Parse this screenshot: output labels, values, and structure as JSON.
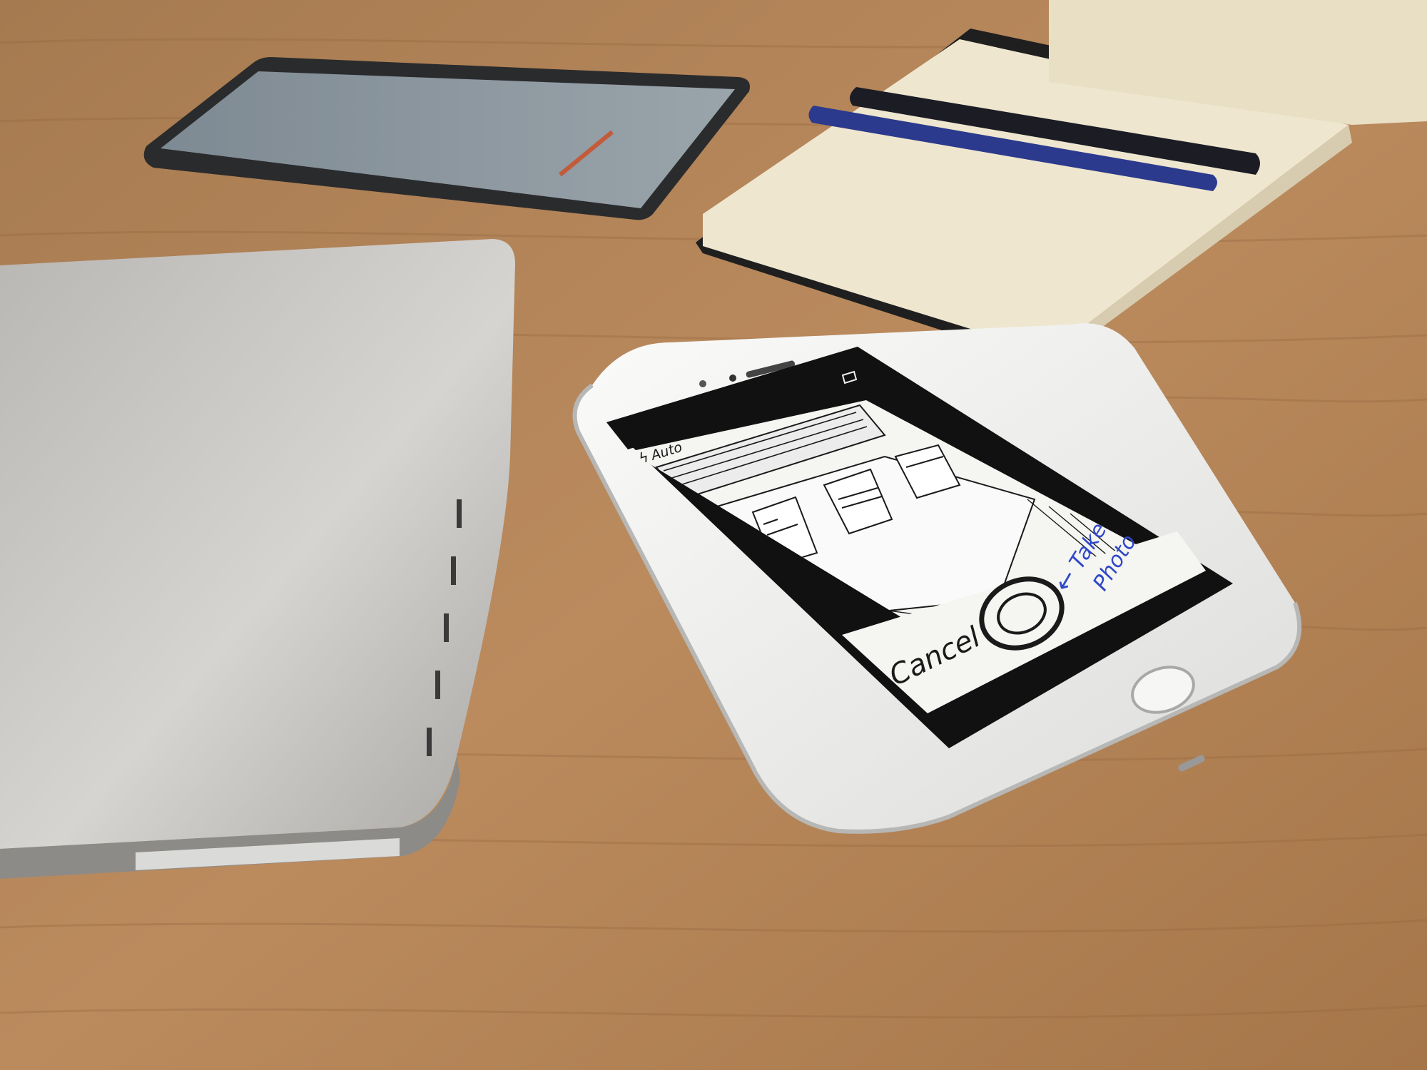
{
  "colors": {
    "desk": "#b8875a",
    "desk_dark": "#9c6f45",
    "laptop": "#c9c7c4",
    "phone_body": "#f1f1ef",
    "screen_bezel": "#111111",
    "sketch_ink": "#1a1a1a",
    "annotation_ink": "#2f47c8",
    "notebook_page": "#efe6cf"
  },
  "phone_screen": {
    "flash_label": "Auto",
    "cancel_label": "Cancel",
    "annotation_line1": "Take",
    "annotation_line2": "Photo"
  },
  "icons": {
    "flash": "flash-icon",
    "camera_switch": "camera-switch-icon",
    "shutter": "shutter-button-icon",
    "arrow": "arrow-left-icon"
  }
}
